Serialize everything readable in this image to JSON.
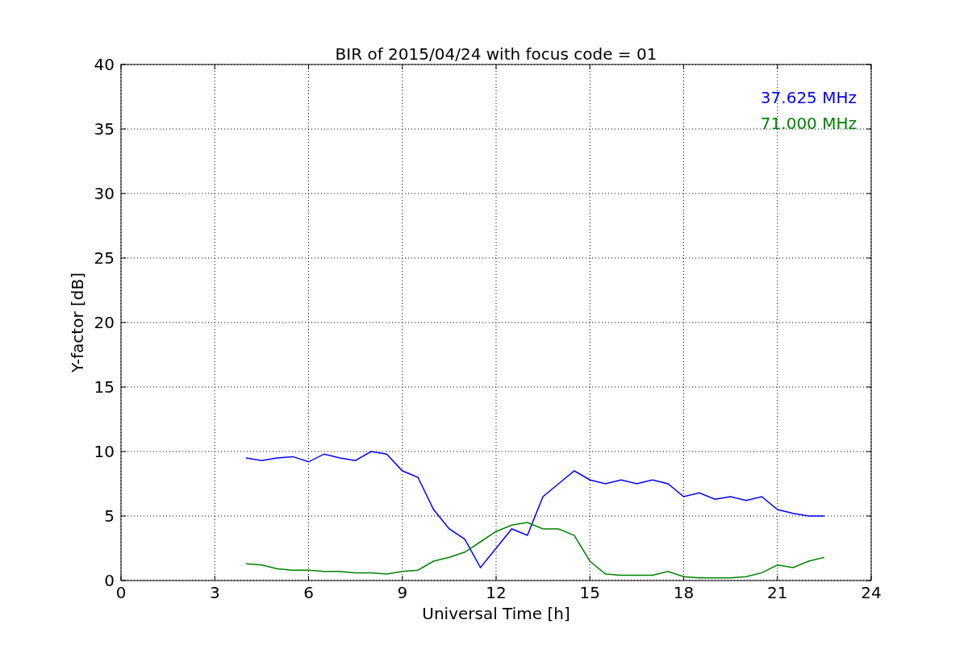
{
  "figure": {
    "chart_data": {
      "type": "line",
      "title": "BIR of 2015/04/24 with focus code = 01",
      "xlabel": "Universal Time [h]",
      "ylabel": "Y-factor [dB]",
      "x": [
        4,
        4.5,
        5,
        5.5,
        6,
        6.5,
        7,
        7.5,
        8,
        8.5,
        9,
        9.5,
        10,
        10.5,
        11,
        11.5,
        12,
        12.5,
        13,
        13.5,
        14,
        14.5,
        15,
        15.5,
        16,
        16.5,
        17,
        17.5,
        18,
        18.5,
        19,
        19.5,
        20,
        20.5,
        21,
        21.5,
        22,
        22.5
      ],
      "series": [
        {
          "name": "37.625 MHz",
          "color": "#0000ff",
          "values": [
            9.5,
            9.3,
            9.5,
            9.6,
            9.2,
            9.8,
            9.5,
            9.3,
            10,
            9.8,
            8.5,
            8,
            5.5,
            4,
            3.2,
            1,
            2.5,
            4,
            3.5,
            6.5,
            7.5,
            8.5,
            7.8,
            7.5,
            7.8,
            7.5,
            7.8,
            7.5,
            6.5,
            6.8,
            6.3,
            6.5,
            6.2,
            6.5,
            5.5,
            5.2,
            5,
            5
          ]
        },
        {
          "name": "71.000 MHz",
          "color": "#008000",
          "values": [
            1.3,
            1.2,
            0.9,
            0.8,
            0.8,
            0.7,
            0.7,
            0.6,
            0.6,
            0.5,
            0.7,
            0.8,
            1.5,
            1.8,
            2.2,
            3,
            3.8,
            4.3,
            4.5,
            4,
            4,
            3.5,
            1.5,
            0.5,
            0.4,
            0.4,
            0.4,
            0.7,
            0.3,
            0.2,
            0.2,
            0.2,
            0.3,
            0.6,
            1.2,
            1,
            1.5,
            1.8
          ]
        }
      ],
      "grid": true,
      "xlim": [
        0,
        24
      ],
      "ylim": [
        0,
        40
      ],
      "xticks": [
        0,
        3,
        6,
        9,
        12,
        15,
        18,
        21,
        24
      ],
      "yticks": [
        0,
        5,
        10,
        15,
        20,
        25,
        30,
        35,
        40
      ]
    }
  }
}
